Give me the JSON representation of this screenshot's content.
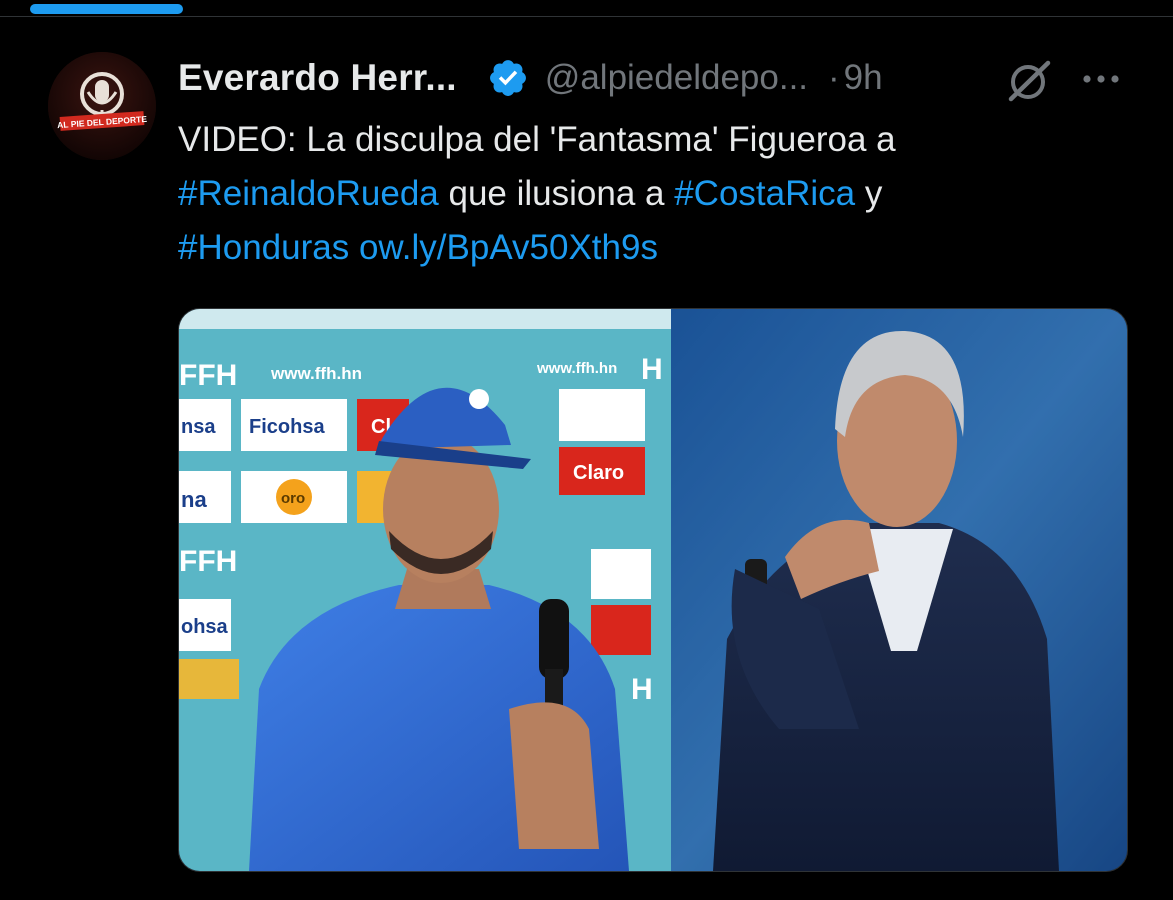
{
  "author": {
    "display_name": "Everardo Herr...",
    "handle": "@alpiedeldepo...",
    "separator": "·",
    "time": "9h",
    "avatar_text": "AL PIE DEL DEPORTE"
  },
  "tweet": {
    "line1": "VIDEO: La disculpa del 'Fantasma' Figueroa a",
    "hashtag1": "#ReinaldoRueda",
    "mid1": " que ilusiona a ",
    "hashtag2": "#CostaRica",
    "mid2": " y",
    "hashtag3": "#Honduras",
    "space": " ",
    "link": "ow.ly/BpAv50Xth9s"
  },
  "media": {
    "backdrop_texts": [
      "www.ffh.hn",
      "www.ffh.hn",
      "FFH",
      "FFH",
      "Ficohsa",
      "Claro",
      "oro",
      "nsa",
      "na",
      "ohsa",
      "Cla",
      "H",
      "H"
    ]
  },
  "icons": {
    "verified": "verified-badge-icon",
    "grok": "grok-icon",
    "more": "more-options-icon"
  },
  "colors": {
    "accent": "#1d9bf0",
    "background": "#000000",
    "text": "#e7e9ea",
    "muted": "#71767b"
  }
}
